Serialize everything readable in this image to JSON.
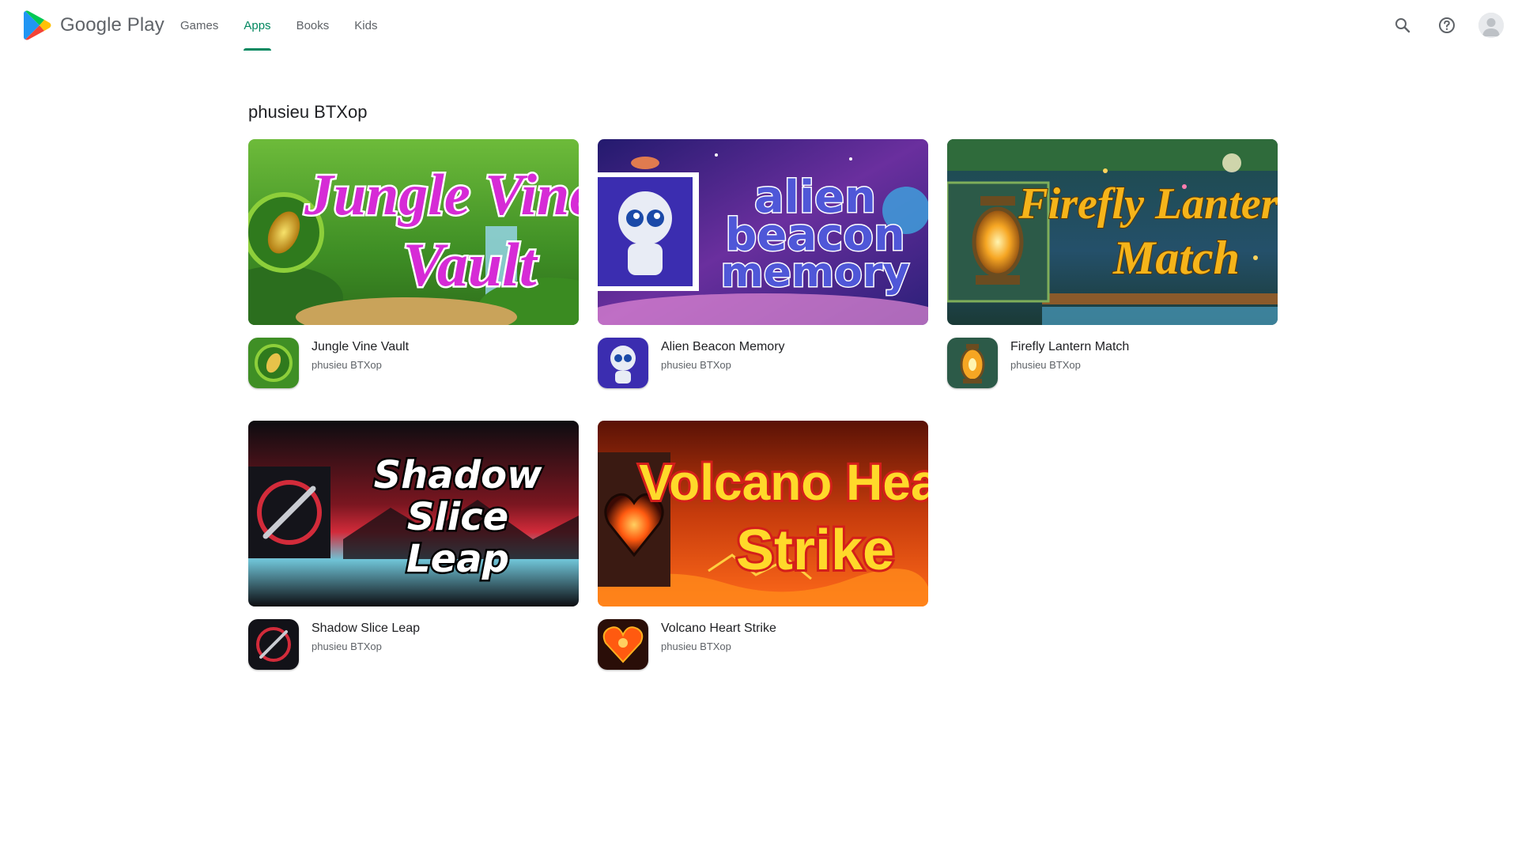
{
  "header": {
    "brand": "Google Play",
    "nav": [
      {
        "label": "Games",
        "active": false
      },
      {
        "label": "Apps",
        "active": true
      },
      {
        "label": "Books",
        "active": false
      },
      {
        "label": "Kids",
        "active": false
      }
    ],
    "icons": [
      "search-icon",
      "help-icon",
      "account-avatar"
    ]
  },
  "page": {
    "title": "phusieu BTXop"
  },
  "apps": [
    {
      "title": "Jungle Vine Vault",
      "developer": "phusieu BTXop",
      "banner_text": [
        "Jungle Vine",
        "Vault"
      ]
    },
    {
      "title": "Alien Beacon Memory",
      "developer": "phusieu BTXop",
      "banner_text": [
        "alien",
        "beacon",
        "memory"
      ]
    },
    {
      "title": "Firefly Lantern Match",
      "developer": "phusieu BTXop",
      "banner_text": [
        "Firefly Lantern",
        "Match"
      ]
    },
    {
      "title": "Shadow Slice Leap",
      "developer": "phusieu BTXop",
      "banner_text": [
        "Shadow",
        "Slice",
        "Leap"
      ]
    },
    {
      "title": "Volcano Heart Strike",
      "developer": "phusieu BTXop",
      "banner_text": [
        "Volcano Heart",
        "Strike"
      ]
    }
  ],
  "colors": {
    "accent": "#01875f",
    "text_primary": "#202124",
    "text_secondary": "#5f6368"
  }
}
